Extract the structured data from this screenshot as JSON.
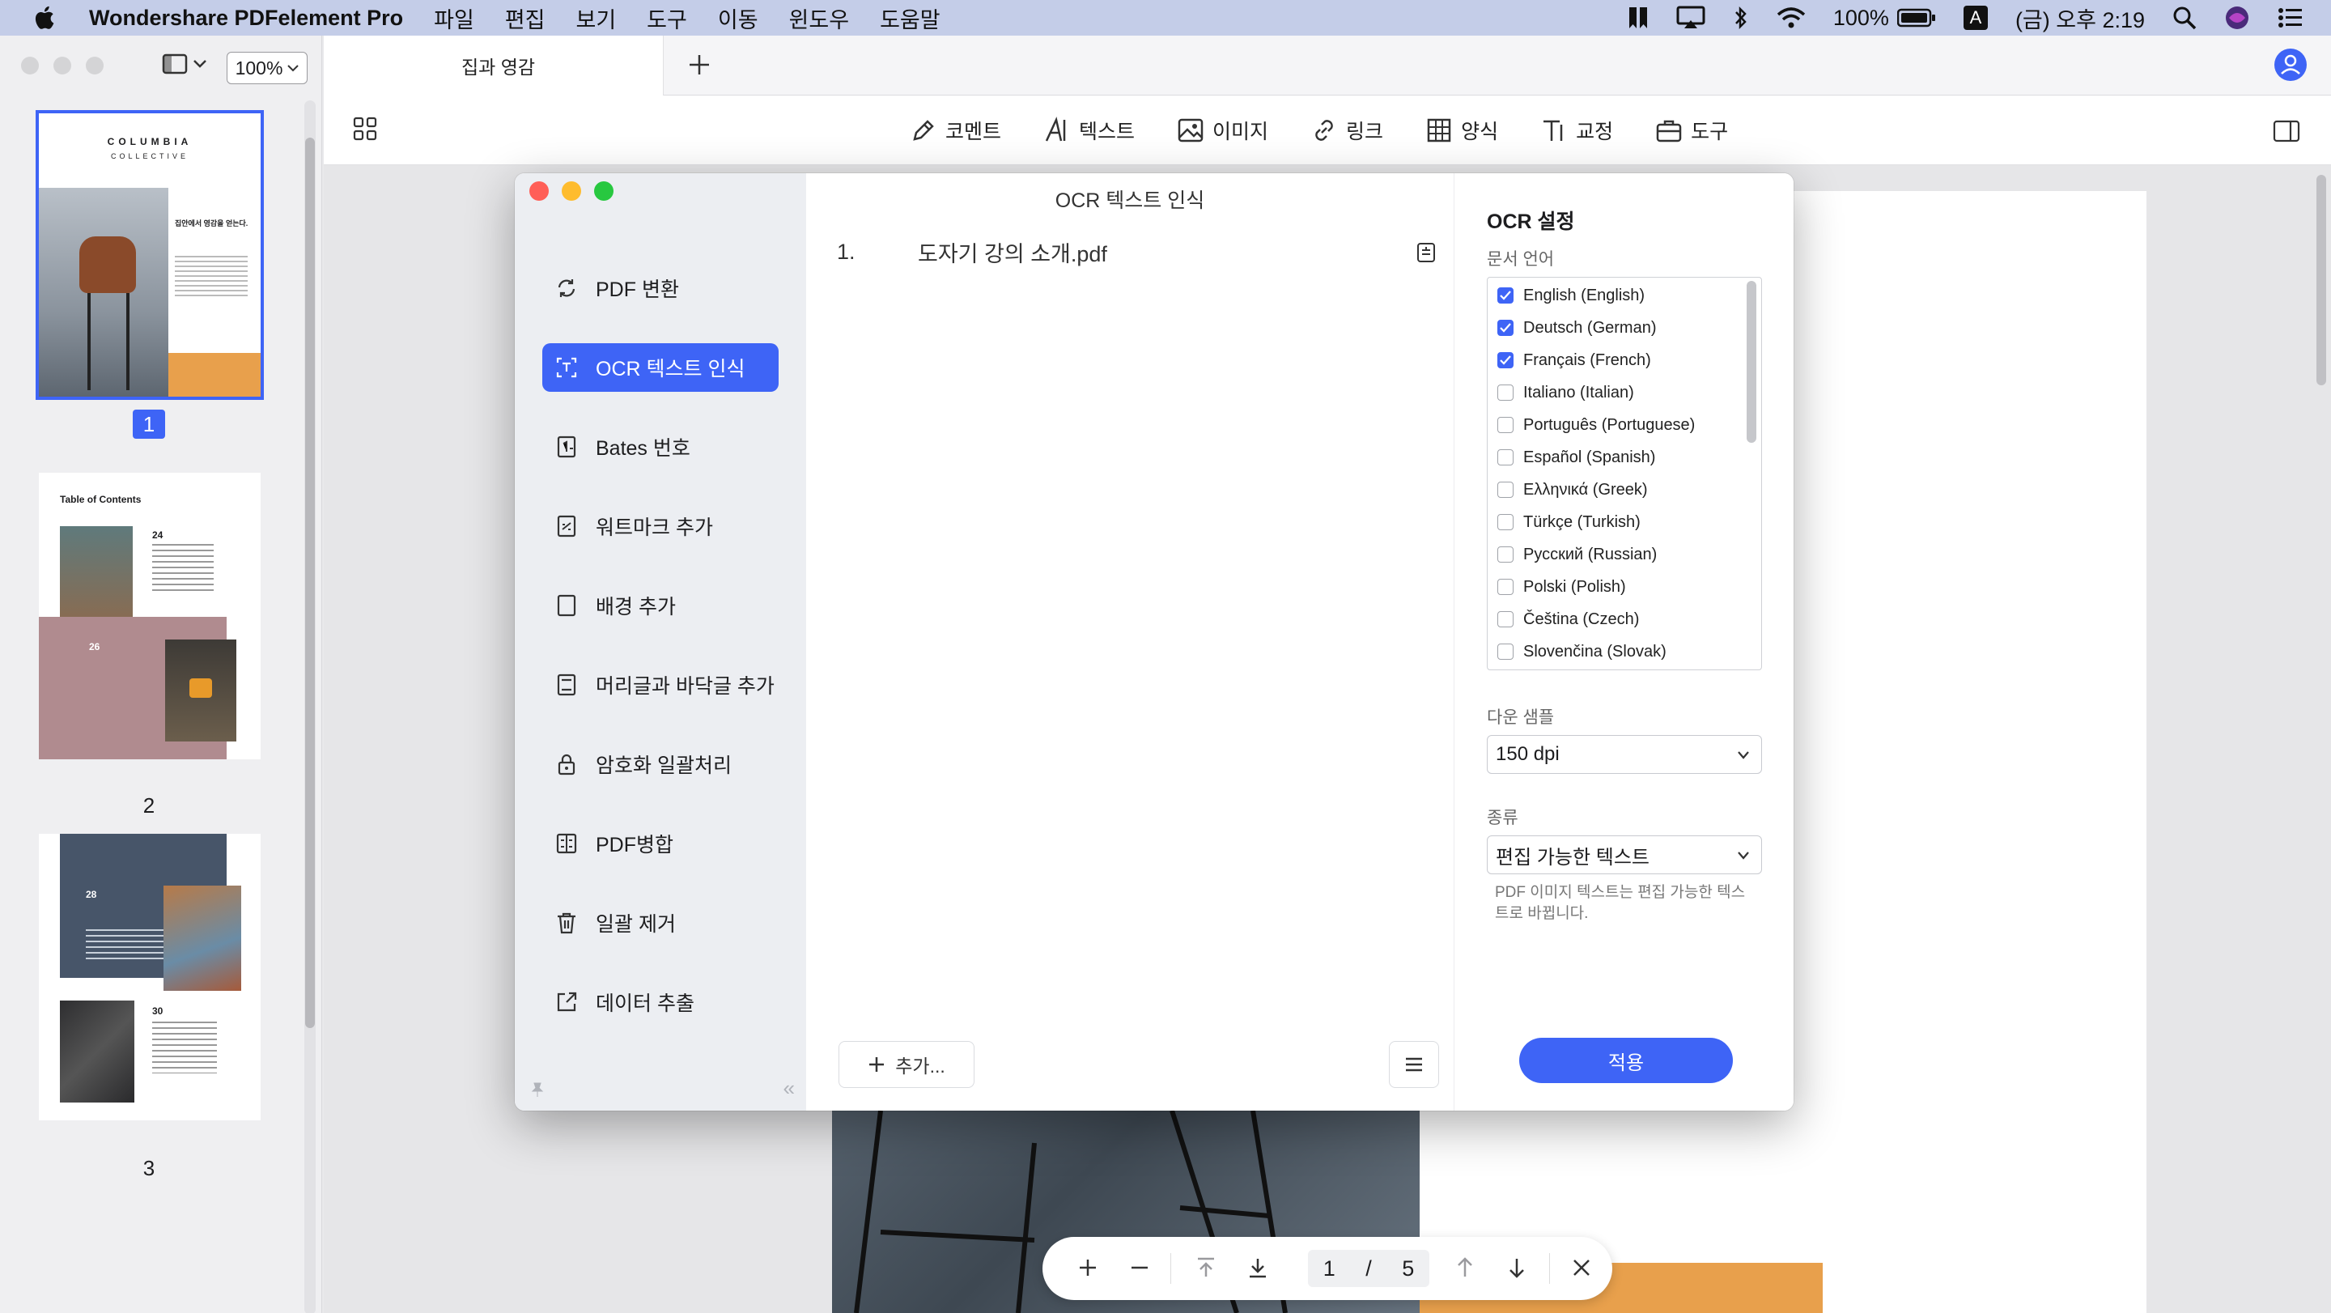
{
  "menubar": {
    "app_name": "Wondershare PDFelement Pro",
    "items": [
      "파일",
      "편집",
      "보기",
      "도구",
      "이동",
      "윈도우",
      "도움말"
    ],
    "battery": "100%",
    "input_source": "A",
    "clock": "(금) 오후 2:19"
  },
  "leftpane": {
    "zoom": "100%",
    "thumbnails": [
      {
        "page": "1",
        "selected": true,
        "title": "COLUMBIA",
        "subtitle": "COLLECTIVE",
        "heading": "집안에서 영감을 얻는다."
      },
      {
        "page": "2",
        "selected": false,
        "title": "Table of Contents",
        "entry1_num": "24",
        "entry2_num": "26"
      },
      {
        "page": "3",
        "selected": false,
        "entry1_num": "28",
        "entry2_num": "30"
      }
    ]
  },
  "tabbar": {
    "doc_tab": "집과 영감"
  },
  "toolbar": {
    "tools": [
      {
        "label": "코멘트",
        "icon": "pen-icon"
      },
      {
        "label": "텍스트",
        "icon": "text-icon"
      },
      {
        "label": "이미지",
        "icon": "image-icon"
      },
      {
        "label": "링크",
        "icon": "link-icon"
      },
      {
        "label": "양식",
        "icon": "table-icon"
      },
      {
        "label": "교정",
        "icon": "redact-icon"
      },
      {
        "label": "도구",
        "icon": "toolbox-icon"
      }
    ]
  },
  "navpill": {
    "current_page": "1",
    "separator": "/",
    "total_pages": "5"
  },
  "dialog": {
    "title": "OCR 텍스트 인식",
    "menu": [
      {
        "label": "PDF 변환",
        "icon": "convert-icon",
        "active": false
      },
      {
        "label": "OCR 텍스트 인식",
        "icon": "ocr-icon",
        "active": true
      },
      {
        "label": "Bates 번호",
        "icon": "bates-icon",
        "active": false
      },
      {
        "label": "워트마크 추가",
        "icon": "watermark-icon",
        "active": false
      },
      {
        "label": "배경 추가",
        "icon": "background-icon",
        "active": false
      },
      {
        "label": "머리글과 바닥글 추가",
        "icon": "header-footer-icon",
        "active": false
      },
      {
        "label": "암호화 일괄처리",
        "icon": "lock-icon",
        "active": false
      },
      {
        "label": "PDF병합",
        "icon": "merge-icon",
        "active": false
      },
      {
        "label": "일괄 제거",
        "icon": "trash-icon",
        "active": false
      },
      {
        "label": "데이터 추출",
        "icon": "export-icon",
        "active": false
      }
    ],
    "files": [
      {
        "index": "1.",
        "name": "도자기 강의 소개.pdf"
      }
    ],
    "add_label": "추가...",
    "settings": {
      "title": "OCR 설정",
      "language_label": "문서 언어",
      "languages": [
        {
          "label": "English (English)",
          "checked": true
        },
        {
          "label": "Deutsch (German)",
          "checked": true
        },
        {
          "label": "Français (French)",
          "checked": true
        },
        {
          "label": "Italiano (Italian)",
          "checked": false
        },
        {
          "label": "Português (Portuguese)",
          "checked": false
        },
        {
          "label": "Español (Spanish)",
          "checked": false
        },
        {
          "label": "Ελληνικά (Greek)",
          "checked": false
        },
        {
          "label": "Türkçe (Turkish)",
          "checked": false
        },
        {
          "label": "Русский (Russian)",
          "checked": false
        },
        {
          "label": "Polski (Polish)",
          "checked": false
        },
        {
          "label": "Čeština (Czech)",
          "checked": false
        },
        {
          "label": "Slovenčina (Slovak)",
          "checked": false
        }
      ],
      "downsample_label": "다운 샘플",
      "downsample_value": "150 dpi",
      "type_label": "종류",
      "type_value": "편집 가능한 텍스트",
      "hint": "PDF 이미지 텍스트는 편집 가능한 텍스트로 바뀝니다.",
      "apply_label": "적용"
    }
  },
  "colors": {
    "accent": "#3e64f6",
    "menubar": "#c4cde8",
    "orange": "#e8a04c"
  }
}
